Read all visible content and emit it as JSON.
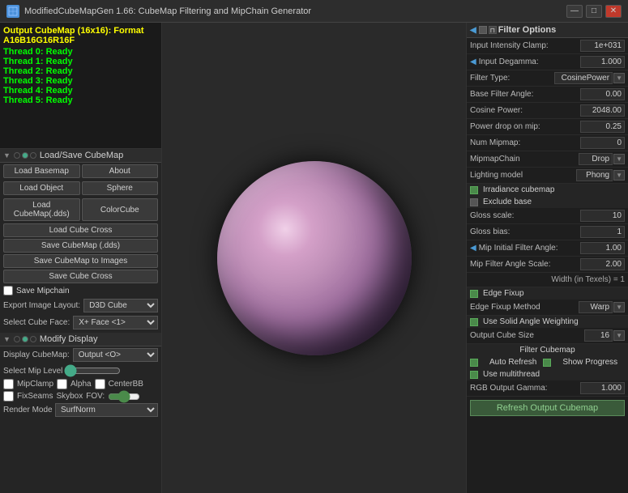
{
  "titleBar": {
    "icon": "M",
    "title": "ModifiedCubeMapGen 1.66: CubeMap Filtering and MipChain Generator",
    "minimizeLabel": "—",
    "maximizeLabel": "□",
    "closeLabel": "✕"
  },
  "statusArea": {
    "outputTitle": "Output CubeMap (16x16): Format A16B16G16R16F",
    "threads": [
      {
        "label": "Thread 0: Ready"
      },
      {
        "label": "Thread 1: Ready"
      },
      {
        "label": "Thread 2: Ready"
      },
      {
        "label": "Thread 3: Ready"
      },
      {
        "label": "Thread 4: Ready"
      },
      {
        "label": "Thread 5: Ready"
      }
    ]
  },
  "loadSavePanel": {
    "title": "Load/Save CubeMap",
    "buttons": {
      "loadBasemap": "Load Basemap",
      "about": "About",
      "loadObject": "Load Object",
      "sphere": "Sphere",
      "loadCubeMapDds": "Load CubeMap(.dds)",
      "colorCube": "ColorCube",
      "loadCubeCross": "Load Cube Cross",
      "saveCubeMapDds": "Save CubeMap (.dds)",
      "saveCubeMapImages": "Save CubeMap to Images",
      "saveCubeCross": "Save Cube Cross",
      "saveMipchain": "Save Mipchain"
    },
    "exportImageLayout": {
      "label": "Export Image Layout:",
      "value": "D3D Cube"
    },
    "selectCubeFace": {
      "label": "Select Cube Face:",
      "value": "X+ Face <1>"
    }
  },
  "modifyDisplayPanel": {
    "title": "Modify Display",
    "displayCubeMap": {
      "label": "Display CubeMap:",
      "value": "Output <O>"
    },
    "selectMipLevel": {
      "label": "Select Mip Level"
    },
    "checkboxes": {
      "mipClamp": "MipClamp",
      "alpha": "Alpha",
      "centerBB": "CenterBB",
      "fixSeams": "FixSeams",
      "skybox": "Skybox"
    },
    "fov": {
      "label": "FOV:",
      "value": ""
    },
    "renderMode": {
      "label": "Render Mode",
      "value": "SurfNorm"
    }
  },
  "filterOptions": {
    "title": "Filter Options",
    "inputIntensityClamp": {
      "label": "Input Intensity Clamp:",
      "value": "1e+031"
    },
    "inputDegamma": {
      "label": "Input Degamma:",
      "value": "1.000"
    },
    "filterType": {
      "label": "Filter Type:",
      "value": "CosinePower"
    },
    "baseFilterAngle": {
      "label": "Base Filter Angle:",
      "value": "0.00"
    },
    "cosinePower": {
      "label": "Cosine Power:",
      "value": "2048.00"
    },
    "powerDropOnMip": {
      "label": "Power drop on mip:",
      "value": "0.25"
    },
    "numMipmap": {
      "label": "Num Mipmap:",
      "value": "0"
    },
    "mipmapChain": {
      "label": "MipmapChain",
      "value": "Drop"
    },
    "lightingModel": {
      "label": "Lighting model",
      "value": "Phong"
    },
    "irradianceCubemap": "Irradiance cubemap",
    "excludeBase": "Exclude base",
    "glossScale": {
      "label": "Gloss scale:",
      "value": "10"
    },
    "glossBias": {
      "label": "Gloss bias:",
      "value": "1"
    },
    "mipInitialFilterAngle": {
      "label": "Mip Initial Filter Angle:",
      "value": "1.00"
    },
    "mipFilterAngleScale": {
      "label": "Mip Filter Angle Scale:",
      "value": "2.00"
    },
    "widthInTexels": "Width (in Texels) = 1",
    "edgeFixup": "Edge Fixup",
    "edgeFixupMethod": {
      "label": "Edge Fixup Method",
      "value": "Warp"
    },
    "useSolidAngleWeighting": "Use Solid Angle Weighting",
    "outputCubeSize": {
      "label": "Output Cube Size",
      "value": "16"
    },
    "filterCubemap": "Filter Cubemap",
    "autoRefresh": "Auto Refresh",
    "showProgress": "Show Progress",
    "useMultithread": "Use multithread",
    "rgbOutputGamma": {
      "label": "RGB Output Gamma:",
      "value": "1.000"
    },
    "refreshButton": "Refresh Output Cubemap"
  }
}
